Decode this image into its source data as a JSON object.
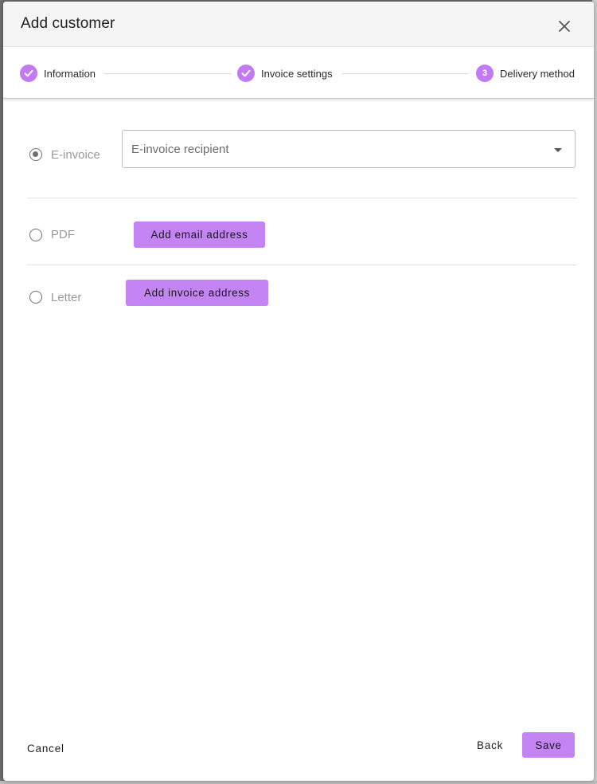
{
  "dialog": {
    "title": "Add customer",
    "close_icon": "close-icon"
  },
  "stepper": {
    "steps": [
      {
        "label": "Information",
        "state": "completed",
        "icon": "check-icon"
      },
      {
        "label": "Invoice settings",
        "state": "completed",
        "icon": "check-icon"
      },
      {
        "label": "Delivery method",
        "state": "active",
        "number": "3"
      }
    ]
  },
  "delivery": {
    "einvoice": {
      "label": "E-invoice",
      "selected": true,
      "select_placeholder": "E-invoice recipient"
    },
    "pdf": {
      "label": "PDF",
      "selected": false,
      "button_label": "Add email address"
    },
    "letter": {
      "label": "Letter",
      "selected": false,
      "button_label": "Add invoice address"
    }
  },
  "footer": {
    "cancel_label": "Cancel",
    "back_label": "Back",
    "save_label": "Save"
  },
  "colors": {
    "accent": "#c584f3",
    "header_bg": "#f5f5f5"
  }
}
